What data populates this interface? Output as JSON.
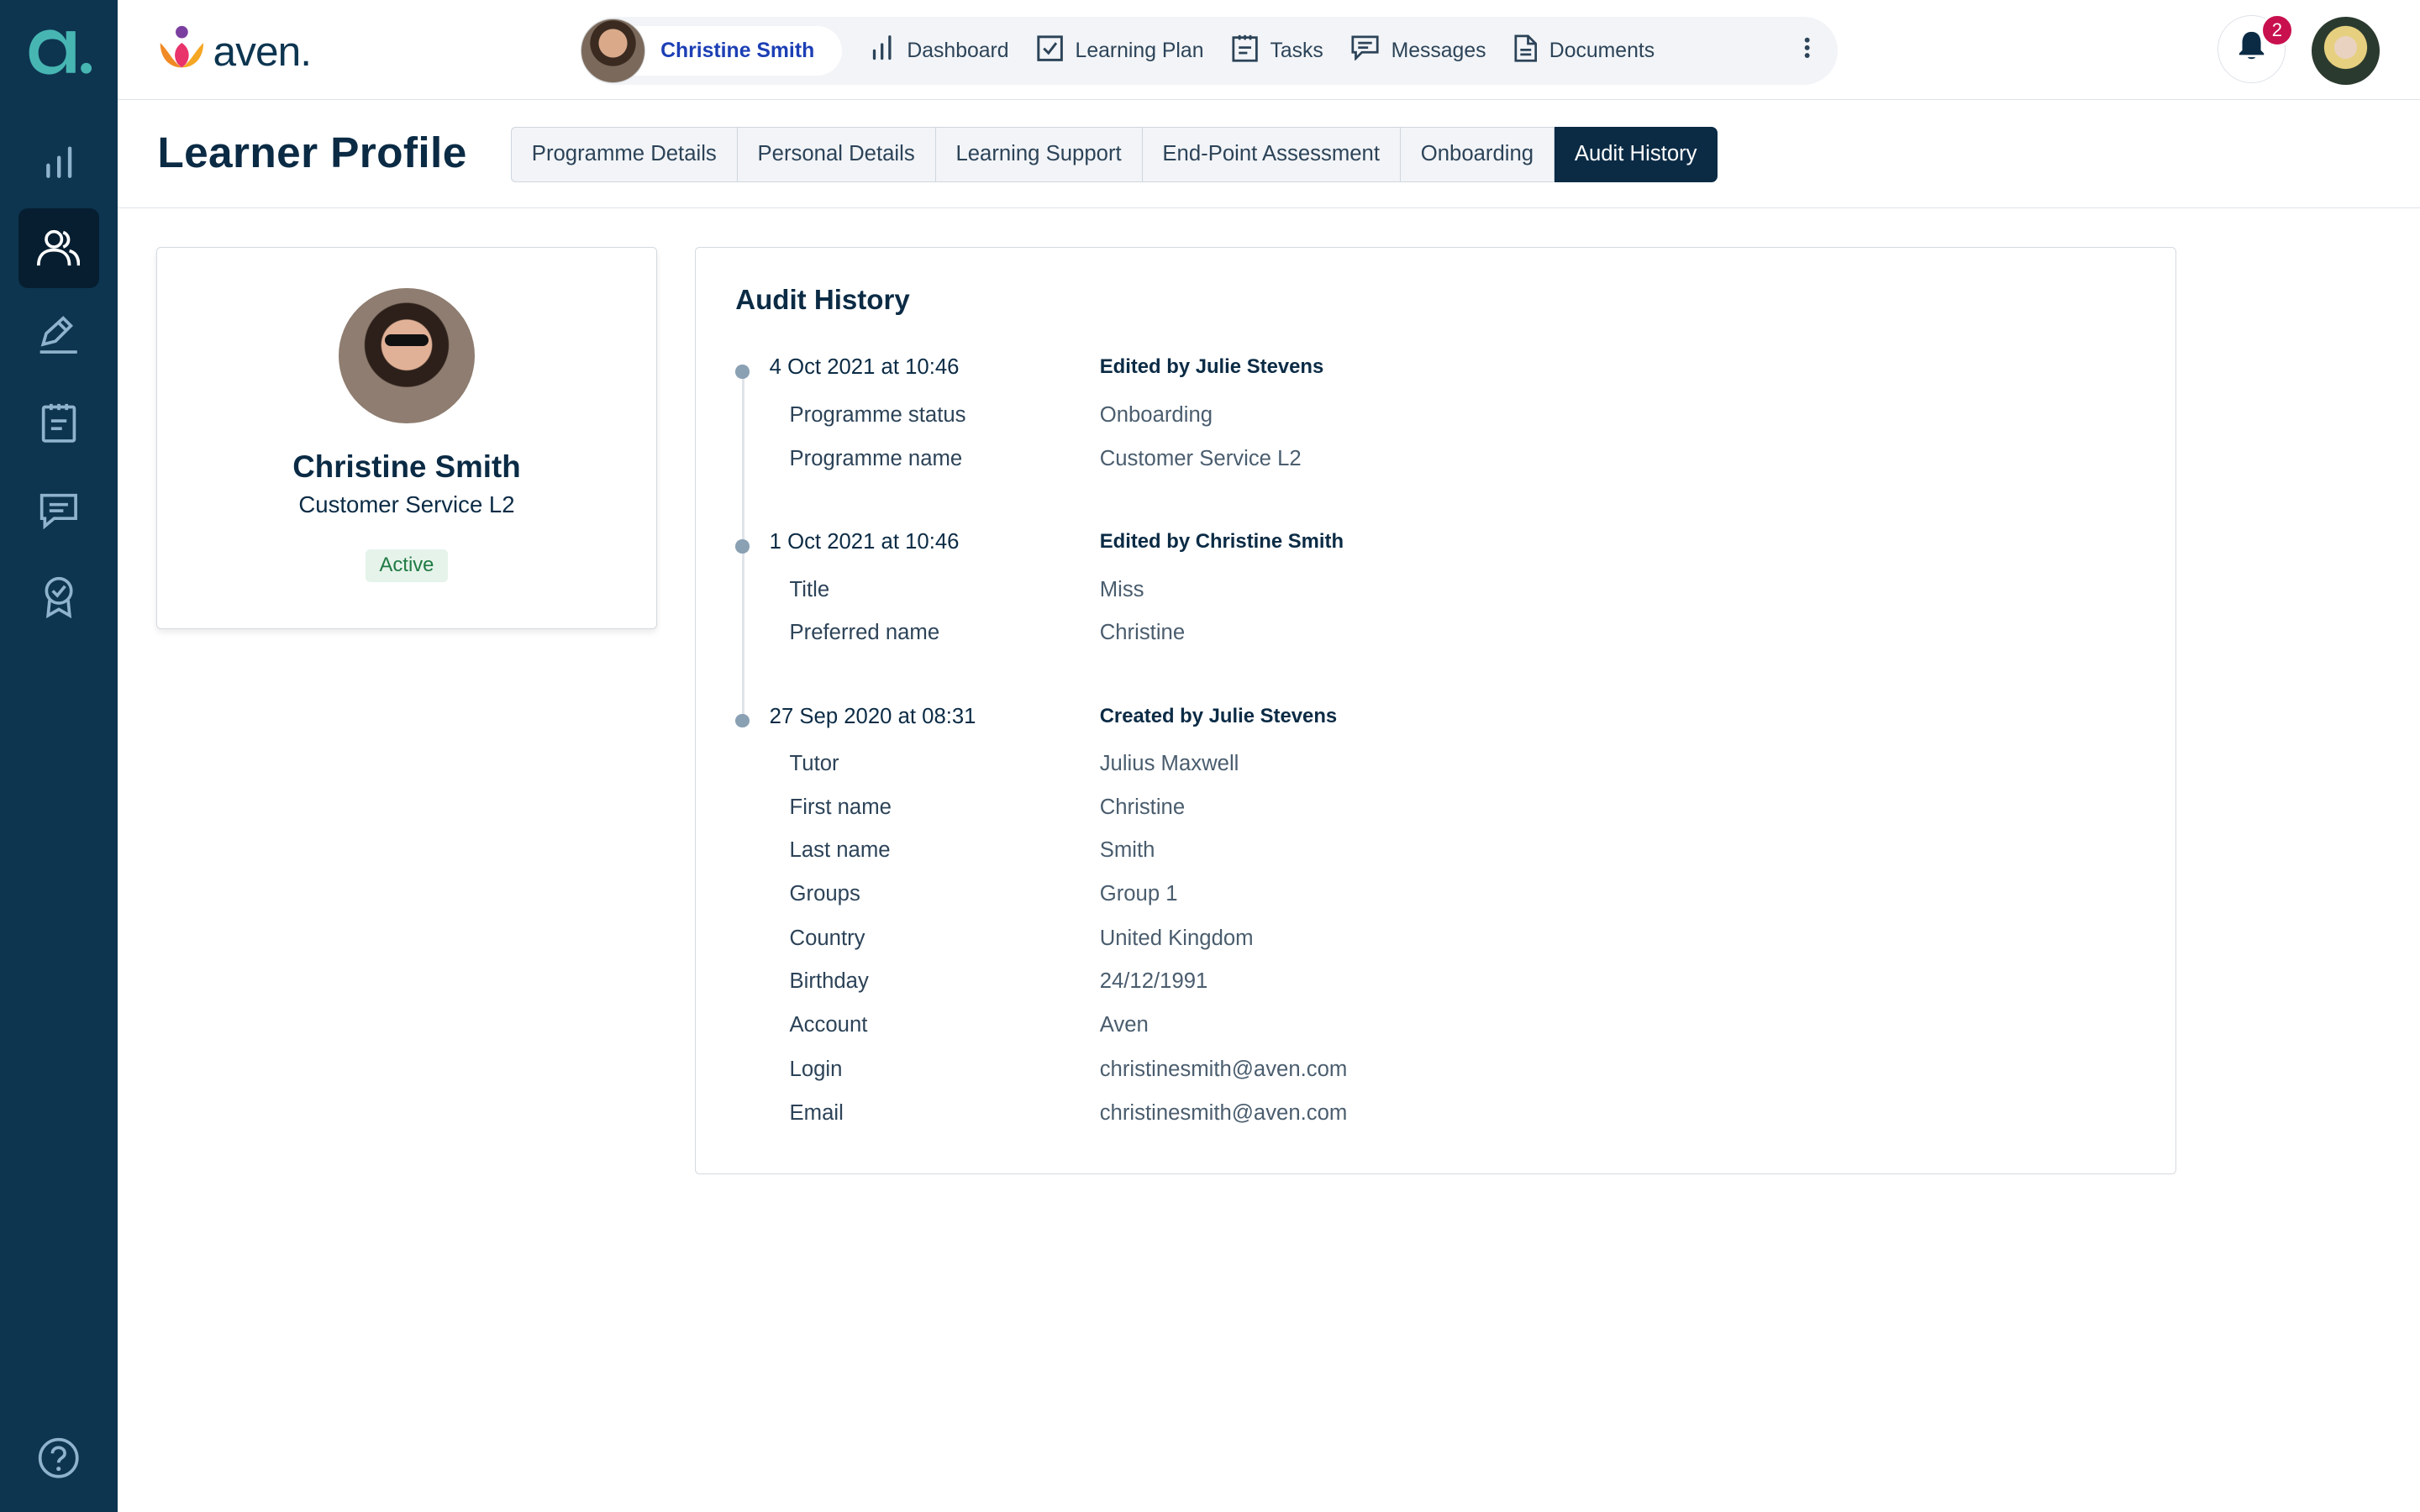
{
  "app": {
    "brand_name": "aven.",
    "rail_logo": "a-logo",
    "accent_color": "#0d3550",
    "alert_color": "#c8104e"
  },
  "rail": {
    "items": [
      {
        "icon": "bar-chart-icon"
      },
      {
        "icon": "users-icon",
        "active": true
      },
      {
        "icon": "pen-icon"
      },
      {
        "icon": "clipboard-icon"
      },
      {
        "icon": "chat-icon"
      },
      {
        "icon": "award-icon"
      }
    ],
    "help_icon": "help-circle-icon"
  },
  "topnav": {
    "learner_name": "Christine Smith",
    "items": [
      {
        "label": "Dashboard",
        "icon": "bar-chart-icon"
      },
      {
        "label": "Learning Plan",
        "icon": "checkbox-icon"
      },
      {
        "label": "Tasks",
        "icon": "clipboard-icon"
      },
      {
        "label": "Messages",
        "icon": "chat-icon"
      },
      {
        "label": "Documents",
        "icon": "document-icon"
      }
    ],
    "notifications_count": "2"
  },
  "header": {
    "title": "Learner Profile",
    "tabs": [
      {
        "label": "Programme Details"
      },
      {
        "label": "Personal Details"
      },
      {
        "label": "Learning Support"
      },
      {
        "label": "End-Point Assessment"
      },
      {
        "label": "Onboarding"
      },
      {
        "label": "Audit History",
        "active": true
      }
    ]
  },
  "profile": {
    "name": "Christine Smith",
    "programme": "Customer Service L2",
    "status": "Active"
  },
  "audit": {
    "title": "Audit History",
    "entries": [
      {
        "date": "4 Oct 2021 at 10:46",
        "by": "Edited by Julie Stevens",
        "rows": [
          {
            "k": "Programme status",
            "v": "Onboarding"
          },
          {
            "k": "Programme name",
            "v": "Customer Service L2"
          }
        ]
      },
      {
        "date": "1 Oct 2021 at 10:46",
        "by": "Edited by Christine Smith",
        "rows": [
          {
            "k": "Title",
            "v": "Miss"
          },
          {
            "k": "Preferred name",
            "v": "Christine"
          }
        ]
      },
      {
        "date": "27 Sep 2020 at 08:31",
        "by": "Created by Julie Stevens",
        "rows": [
          {
            "k": "Tutor",
            "v": "Julius Maxwell"
          },
          {
            "k": "First name",
            "v": "Christine"
          },
          {
            "k": "Last name",
            "v": "Smith"
          },
          {
            "k": "Groups",
            "v": "Group 1"
          },
          {
            "k": "Country",
            "v": "United Kingdom"
          },
          {
            "k": "Birthday",
            "v": "24/12/1991"
          },
          {
            "k": "Account",
            "v": "Aven"
          },
          {
            "k": "Login",
            "v": "christinesmith@aven.com"
          },
          {
            "k": "Email",
            "v": "christinesmith@aven.com"
          }
        ]
      }
    ]
  }
}
